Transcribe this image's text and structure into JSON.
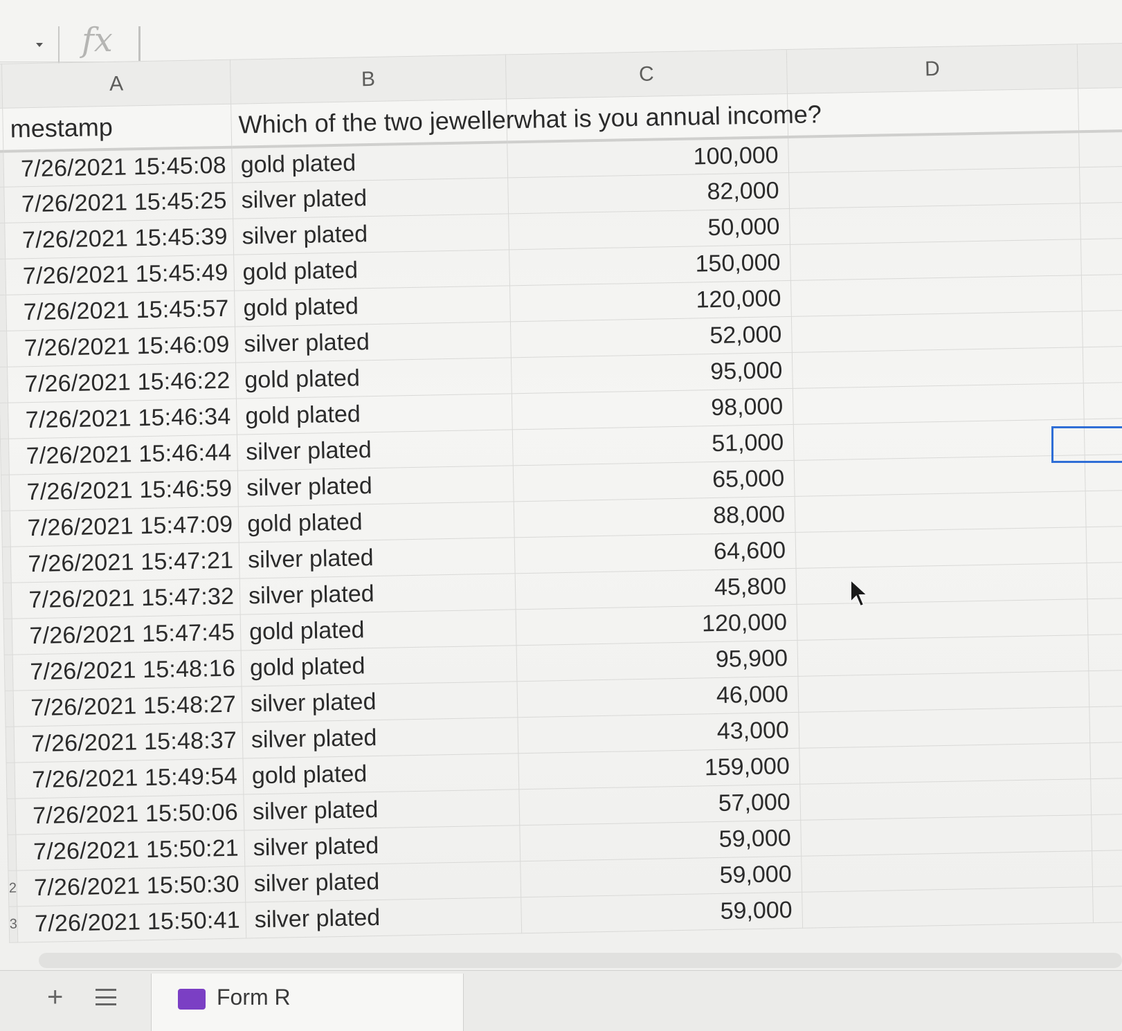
{
  "formula_bar": {
    "fx_label": "fx"
  },
  "columns": [
    "A",
    "B",
    "C",
    "D"
  ],
  "header_row": {
    "a": "mestamp",
    "b": "Which of the two jeweller",
    "c": "what is you annual income?"
  },
  "rows": [
    {
      "timestamp": "7/26/2021 15:45:08",
      "choice": "gold plated",
      "income": "100,000"
    },
    {
      "timestamp": "7/26/2021 15:45:25",
      "choice": "silver plated",
      "income": "82,000"
    },
    {
      "timestamp": "7/26/2021 15:45:39",
      "choice": "silver plated",
      "income": "50,000"
    },
    {
      "timestamp": "7/26/2021 15:45:49",
      "choice": "gold plated",
      "income": "150,000"
    },
    {
      "timestamp": "7/26/2021 15:45:57",
      "choice": "gold plated",
      "income": "120,000"
    },
    {
      "timestamp": "7/26/2021 15:46:09",
      "choice": "silver plated",
      "income": "52,000"
    },
    {
      "timestamp": "7/26/2021 15:46:22",
      "choice": "gold plated",
      "income": "95,000"
    },
    {
      "timestamp": "7/26/2021 15:46:34",
      "choice": "gold plated",
      "income": "98,000"
    },
    {
      "timestamp": "7/26/2021 15:46:44",
      "choice": "silver plated",
      "income": "51,000"
    },
    {
      "timestamp": "7/26/2021 15:46:59",
      "choice": "silver plated",
      "income": "65,000"
    },
    {
      "timestamp": "7/26/2021 15:47:09",
      "choice": "gold plated",
      "income": "88,000"
    },
    {
      "timestamp": "7/26/2021 15:47:21",
      "choice": "silver plated",
      "income": "64,600"
    },
    {
      "timestamp": "7/26/2021 15:47:32",
      "choice": "silver plated",
      "income": "45,800"
    },
    {
      "timestamp": "7/26/2021 15:47:45",
      "choice": "gold plated",
      "income": "120,000"
    },
    {
      "timestamp": "7/26/2021 15:48:16",
      "choice": "gold plated",
      "income": "95,900"
    },
    {
      "timestamp": "7/26/2021 15:48:27",
      "choice": "silver plated",
      "income": "46,000"
    },
    {
      "timestamp": "7/26/2021 15:48:37",
      "choice": "silver plated",
      "income": "43,000"
    },
    {
      "timestamp": "7/26/2021 15:49:54",
      "choice": "gold plated",
      "income": "159,000"
    },
    {
      "timestamp": "7/26/2021 15:50:06",
      "choice": "silver plated",
      "income": "57,000"
    },
    {
      "timestamp": "7/26/2021 15:50:21",
      "choice": "silver plated",
      "income": "59,000"
    },
    {
      "timestamp": "7/26/2021 15:50:30",
      "choice": "silver plated",
      "income": "59,000"
    },
    {
      "timestamp": "7/26/2021 15:50:41",
      "choice": "silver plated",
      "income": "59,000"
    }
  ],
  "row_numbers": {
    "20": "2",
    "21": "3"
  },
  "sheet_tab": {
    "label": "Form R"
  },
  "colors": {
    "selection": "#2f6ed6",
    "form_icon": "#7b3fc4"
  },
  "icons": [
    "chevron-down-icon",
    "fx-icon",
    "mouse-pointer-icon",
    "add-sheet-icon",
    "all-sheets-icon",
    "form-icon"
  ]
}
